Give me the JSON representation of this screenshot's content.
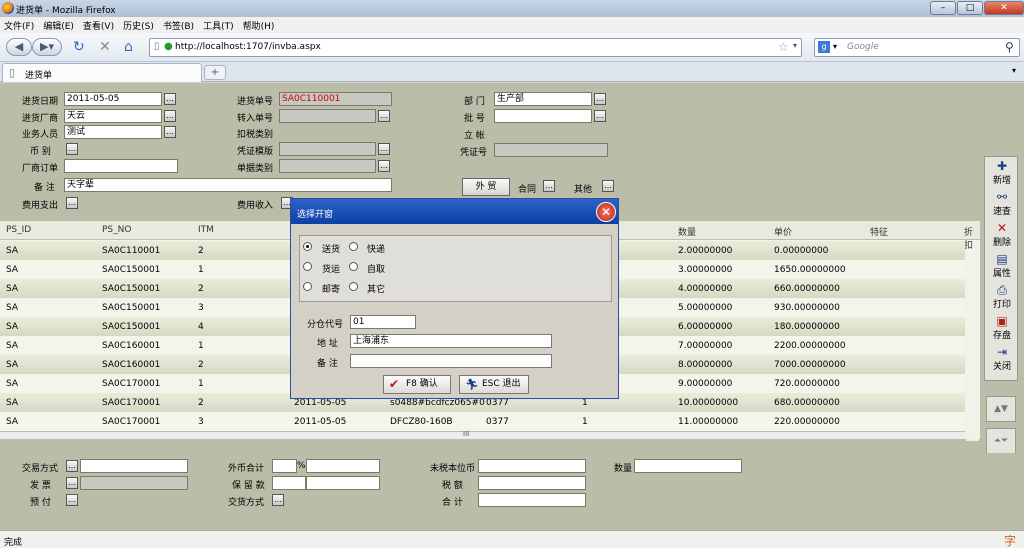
{
  "window": {
    "title": "进货单 - Mozilla Firefox"
  },
  "menu": [
    "文件(F)",
    "编辑(E)",
    "查看(V)",
    "历史(S)",
    "书签(B)",
    "工具(T)",
    "帮助(H)"
  ],
  "nav": {
    "url": "http://localhost:1707/invba.aspx",
    "search_placeholder": "Google"
  },
  "tab": {
    "label": "进货单",
    "new_tab": "+"
  },
  "form": {
    "date_label": "进货日期",
    "date_value": "2011-05-05",
    "vendor_label": "进货厂商",
    "vendor_value": "天云",
    "staff_label": "业务人员",
    "staff_value": "测试",
    "currency_label": "币 别",
    "order_label": "厂商订单",
    "note_label": "备 注",
    "note_value": "天字辈",
    "expense_label": "费用支出",
    "no_label": "进货单号",
    "no_value": "SA0C110001",
    "transfer_label": "转入单号",
    "tax_label": "扣税类别",
    "voucher_tpl_label": "凭证模版",
    "doc_type_label": "单据类别",
    "income_label": "费用收入",
    "dept_label": "部 门",
    "dept_value": "生产部",
    "batch_label": "批 号",
    "account_label": "立 帐",
    "voucher_no_label": "凭证号",
    "foreign_btn": "外 贸",
    "contract_label": "合同",
    "other_label": "其他"
  },
  "grid": {
    "headers": [
      "PS_ID",
      "PS_NO",
      "ITM",
      "数量",
      "单价",
      "特征",
      "折扣"
    ],
    "rows": [
      [
        "SA",
        "SA0C110001",
        "2",
        "",
        "",
        "",
        "",
        "2.00000000",
        "0.00000000"
      ],
      [
        "SA",
        "SA0C150001",
        "1",
        "",
        "",
        "",
        "",
        "3.00000000",
        "1650.00000000"
      ],
      [
        "SA",
        "SA0C150001",
        "2",
        "",
        "",
        "",
        "",
        "4.00000000",
        "660.00000000"
      ],
      [
        "SA",
        "SA0C150001",
        "3",
        "",
        "",
        "",
        "",
        "5.00000000",
        "930.00000000"
      ],
      [
        "SA",
        "SA0C150001",
        "4",
        "",
        "",
        "",
        "",
        "6.00000000",
        "180.00000000"
      ],
      [
        "SA",
        "SA0C160001",
        "1",
        "",
        "",
        "",
        "",
        "7.00000000",
        "2200.00000000"
      ],
      [
        "SA",
        "SA0C160001",
        "2",
        "",
        "",
        "",
        "",
        "8.00000000",
        "7000.00000000"
      ],
      [
        "SA",
        "SA0C170001",
        "1",
        "",
        "",
        "",
        "",
        "9.00000000",
        "720.00000000"
      ],
      [
        "SA",
        "SA0C170001",
        "2",
        "2011-05-05",
        "s0488#bcdfcz065#0",
        "0377",
        "1",
        "10.00000000",
        "680.00000000"
      ],
      [
        "SA",
        "SA0C170001",
        "3",
        "2011-05-05",
        "DFCZ80-160B",
        "0377",
        "1",
        "11.00000000",
        "220.00000000"
      ]
    ],
    "scroll_mid": "III"
  },
  "toolbar": [
    "新增",
    "速查",
    "删除",
    "属性",
    "打印",
    "存盘",
    "关闭"
  ],
  "bottom": {
    "trade_label": "交易方式",
    "invoice_label": "发 票",
    "prepay_label": "预 付",
    "foreign_total_label": "外币合计",
    "percent": "%",
    "retain_label": "保 留 款",
    "delivery_label": "交货方式",
    "untaxed_label": "未税本位币",
    "tax_amount_label": "税 额",
    "total_label": "合 计",
    "qty_label": "数量"
  },
  "modal": {
    "title": "选择开窗",
    "options": [
      "送货",
      "快递",
      "货运",
      "自取",
      "邮寄",
      "其它"
    ],
    "selected_option": "送货",
    "code_label": "分仓代号",
    "code_value": "01",
    "address_label": "地 址",
    "address_value": "上海浦东",
    "note_label": "备 注",
    "note_value": "",
    "ok_label": "F8 确认",
    "cancel_label": "ESC 退出"
  },
  "status": {
    "text": "完成",
    "ime_glyph": "字"
  },
  "colors": {
    "title_blue": "#0c3fa5",
    "red_text": "#d00000",
    "app_bg": "#bcbda8"
  }
}
